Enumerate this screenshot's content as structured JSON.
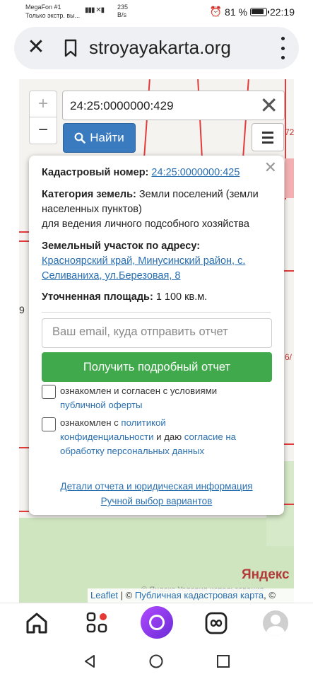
{
  "status_bar": {
    "carrier": "MegaFon #1",
    "carrier_sub": "Только экстр. вы...",
    "speed_value": "235",
    "speed_unit": "B/s",
    "battery": "81 %",
    "time": "22:19"
  },
  "browser": {
    "url": "stroyayakarta.org",
    "close_icon": "close-icon",
    "bookmark_icon": "bookmark-icon",
    "menu_icon": "more-vert-icon"
  },
  "map": {
    "zoom_in": "+",
    "zoom_out": "−",
    "search_value": "24:25:0000000:429",
    "find_label": "Найти",
    "left_edge_label": "9",
    "right_edge_label_top": "72",
    "right_edge_label_mid": "6/",
    "yandex_logo": "Яндекс",
    "yandex_terms": "© Яндекс Условия использования",
    "attribution_leaflet": "Leaflet",
    "attribution_sep": " | © ",
    "attribution_source": "Публичная кадастровая карта",
    "attribution_tail": ", ©"
  },
  "popup": {
    "cadastral_label": "Кадастровый номер:",
    "cadastral_value": "24:25:0000000:425",
    "category_label": "Категория земель:",
    "category_value": "Земли поселений (земли",
    "category_value_2": "населенных пунктов)",
    "usage": "для ведения личного подсобного хозяйства",
    "address_label": "Земельный участок по адресу:",
    "address_line_1": "Красноярский край, Минусинский район, с.",
    "address_line_2": "Селиваниха, ул.Березовая, 8",
    "area_label": "Уточненная площадь:",
    "area_value": "1 100 кв.м.",
    "email_placeholder": "Ваш email, куда отправить отчет",
    "report_button": "Получить подробный отчет",
    "checkbox1_text": "ознакомлен и согласен с условиями",
    "checkbox1_link": "публичной оферты",
    "checkbox2_prefix": "ознакомлен с",
    "checkbox2_link1": "политикой",
    "checkbox2_link1b": "конфиденциальности",
    "checkbox2_mid": "и даю",
    "checkbox2_link2": "согласие на",
    "checkbox2_link2b": "обработку персональных данных",
    "details_link": "Детали отчета и юридическая информация",
    "manual_link": "Ручной выбор вариантов"
  },
  "colors": {
    "accent_blue": "#3a7bc0",
    "green_button": "#3fa94c",
    "link": "#2a6fb0",
    "cadastre_lines": "#e23b3b"
  }
}
